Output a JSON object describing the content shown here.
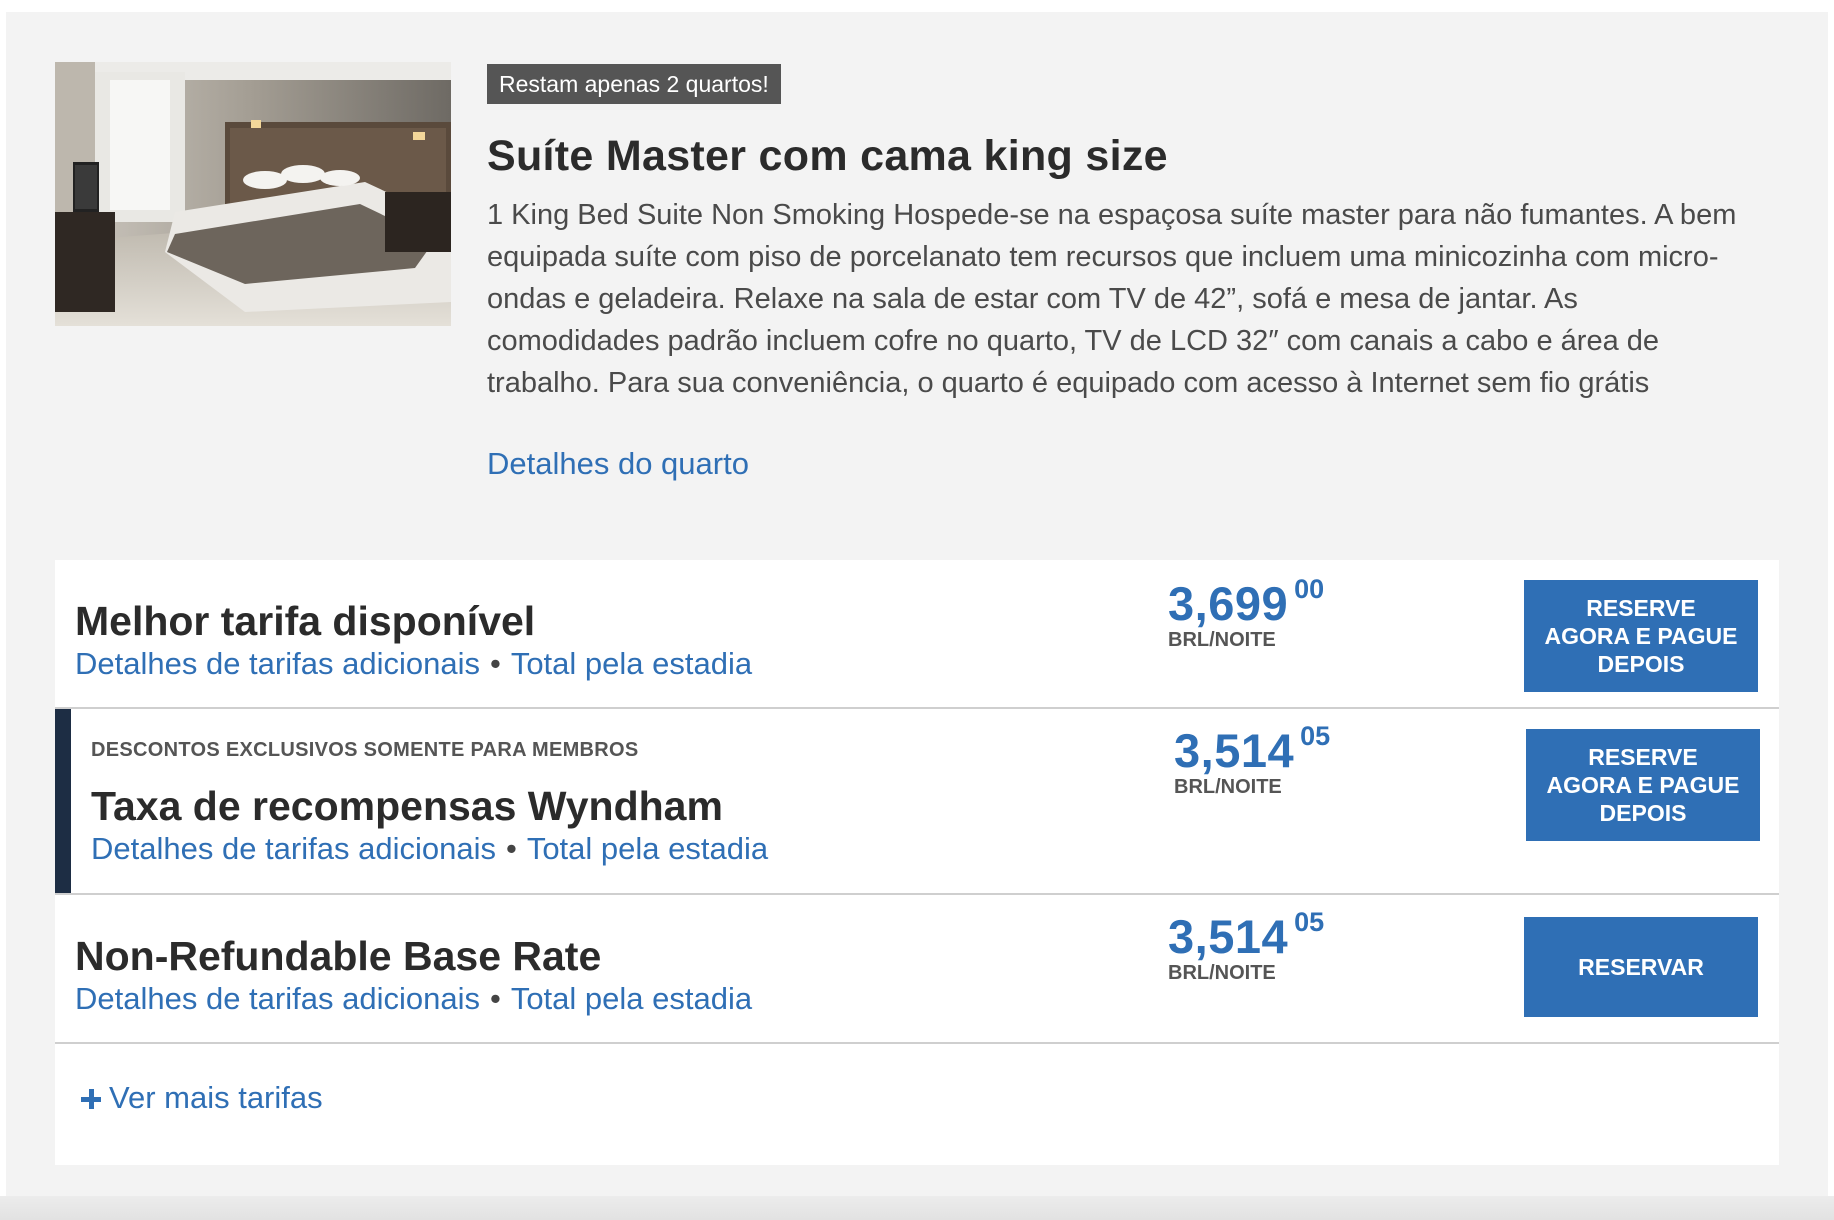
{
  "room": {
    "badge": "Restam apenas 2 quartos!",
    "title": "Suíte Master com cama king size",
    "description": "1 King Bed Suite Non Smoking Hospede-se na espaçosa suíte master para não fumantes. A bem equipada suíte com piso de porcelanato tem recursos que incluem uma minicozinha com micro-ondas e geladeira. Relaxe na sala de estar com TV de 42”, sofá e mesa de jantar. As comodidades padrão incluem cofre no quarto, TV de LCD 32″ com canais a cabo e área de trabalho. Para sua conveniência, o quarto é equipado com acesso à Internet sem fio grátis",
    "details_link": "Detalhes do quarto"
  },
  "rates": [
    {
      "eyebrow": "",
      "name": "Melhor tarifa disponível",
      "details_link": "Detalhes de tarifas adicionais",
      "separator": "•",
      "total_link": "Total pela estadia",
      "price_main": "3,699",
      "price_cents": "00",
      "price_unit": "BRL/NOITE",
      "button": "RESERVE AGORA E PAGUE DEPOIS"
    },
    {
      "eyebrow": "DESCONTOS EXCLUSIVOS SOMENTE PARA MEMBROS",
      "name": "Taxa de recompensas Wyndham",
      "details_link": "Detalhes de tarifas adicionais",
      "separator": "•",
      "total_link": "Total pela estadia",
      "price_main": "3,514",
      "price_cents": "05",
      "price_unit": "BRL/NOITE",
      "button": "RESERVE AGORA E PAGUE DEPOIS"
    },
    {
      "eyebrow": "",
      "name": "Non-Refundable Base Rate",
      "details_link": "Detalhes de tarifas adicionais",
      "separator": "•",
      "total_link": "Total pela estadia",
      "price_main": "3,514",
      "price_cents": "05",
      "price_unit": "BRL/NOITE",
      "button": "RESERVAR"
    }
  ],
  "more_rates": {
    "label": "Ver mais tarifas",
    "icon": "plus-icon"
  },
  "colors": {
    "accent_blue": "#2f6fb5",
    "member_bar": "#1d2d44",
    "badge_bg": "#555555",
    "page_bg": "#f3f3f3"
  }
}
